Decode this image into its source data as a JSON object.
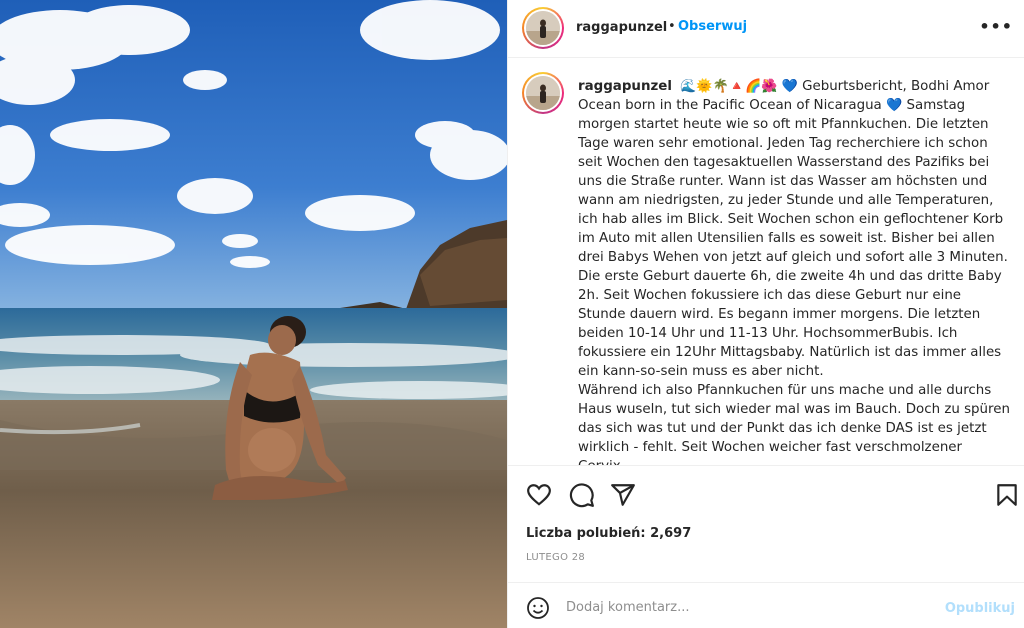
{
  "post": {
    "username": "raggapunzel",
    "separator": "•",
    "follow_label": "Obserwuj",
    "more_label": "•••"
  },
  "caption": {
    "username": "raggapunzel",
    "emojis": "🌊🌞🌴🔺🌈🌺",
    "heart": "💙",
    "line1_text": "Geburtsbericht, Bodhi Amor Ocean born in the Pacific Ocean of Nicaragua",
    "heart2": "💙",
    "paragraph1_rest": "Samstag morgen startet heute wie so oft mit Pfannkuchen. Die letzten Tage waren sehr emotional. Jeden Tag recherchiere ich schon seit Wochen den tagesaktuellen Wasserstand des Pazifiks bei uns die Straße runter. Wann ist das Wasser am höchsten und wann am niedrigsten, zu jeder Stunde und alle Temperaturen, ich hab alles im Blick. Seit Wochen schon ein geflochtener Korb im Auto mit allen Utensilien falls es soweit ist. Bisher bei allen drei Babys Wehen von jetzt auf gleich und sofort alle 3 Minuten. Die erste Geburt dauerte 6h, die zweite 4h und das dritte Baby 2h. Seit Wochen fokussiere ich das diese Geburt nur eine Stunde dauern wird. Es begann immer morgens. Die letzten beiden 10-14 Uhr und 11-13 Uhr. HochsommerBubis. Ich fokussiere ein 12Uhr Mittagsbaby. Natürlich ist das immer alles ein kann-so-sein muss es aber nicht.",
    "paragraph2": "Während ich also Pfannkuchen für uns mache und alle durchs Haus wuseln, tut sich wieder mal was im Bauch. Doch zu spüren das sich was tut und der Punkt das ich denke DAS ist es jetzt wirklich - fehlt. Seit Wochen weicher fast verschmolzener Cervix."
  },
  "actions": {
    "icons": [
      "heart-icon",
      "comment-icon",
      "share-icon",
      "bookmark-icon"
    ]
  },
  "likes_label": "Liczba polubień: 2,697",
  "date_label": "LUTEGO 28",
  "comment": {
    "placeholder": "Dodaj komentarz...",
    "value": "",
    "publish_label": "Opublikuj",
    "emoji_icon": "smile-icon"
  },
  "colors": {
    "link_blue": "#0095f6",
    "publish_disabled": "#b2dffc",
    "text": "#262626",
    "muted": "#8e8e8e",
    "border": "#efefef"
  }
}
